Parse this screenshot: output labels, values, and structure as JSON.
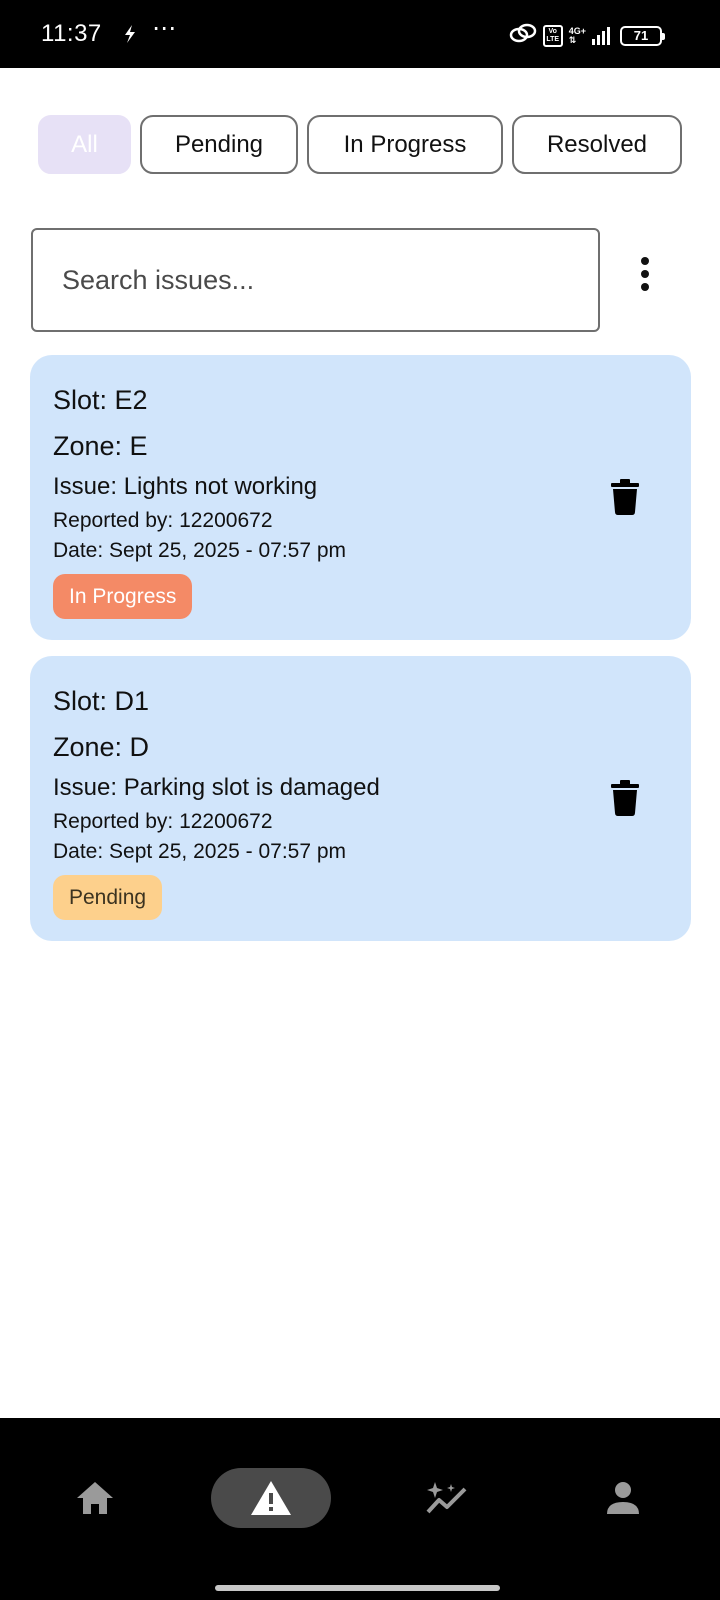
{
  "status_bar": {
    "time": "11:37",
    "dots": "⋯",
    "network": "4G+",
    "volte": "Vo LTE",
    "battery": "71"
  },
  "filters": [
    {
      "label": "All",
      "active": true
    },
    {
      "label": "Pending",
      "active": false
    },
    {
      "label": "In Progress",
      "active": false
    },
    {
      "label": "Resolved",
      "active": false
    }
  ],
  "search": {
    "placeholder": "Search issues..."
  },
  "issues": [
    {
      "slot": "Slot: E2",
      "zone": "Zone: E",
      "issue": "Issue: Lights not working",
      "reported_by": "Reported by: 12200672",
      "date": "Date: Sept 25, 2025 - 07:57 pm",
      "status": "In Progress",
      "status_color": "#f48a66"
    },
    {
      "slot": "Slot: D1",
      "zone": "Zone: D",
      "issue": "Issue: Parking slot is damaged",
      "reported_by": "Reported by: 12200672",
      "date": "Date: Sept 25, 2025 - 07:57 pm",
      "status": "Pending",
      "status_color": "#fdd08c"
    }
  ],
  "bottom_nav": [
    {
      "icon": "home-icon",
      "active": false
    },
    {
      "icon": "warning-icon",
      "active": true
    },
    {
      "icon": "insights-icon",
      "active": false
    },
    {
      "icon": "person-icon",
      "active": false
    }
  ],
  "colors": {
    "card_bg": "#d1e5fb",
    "active_chip_bg": "#e7e1f6",
    "nav_active_pill": "#4a4a4a"
  }
}
